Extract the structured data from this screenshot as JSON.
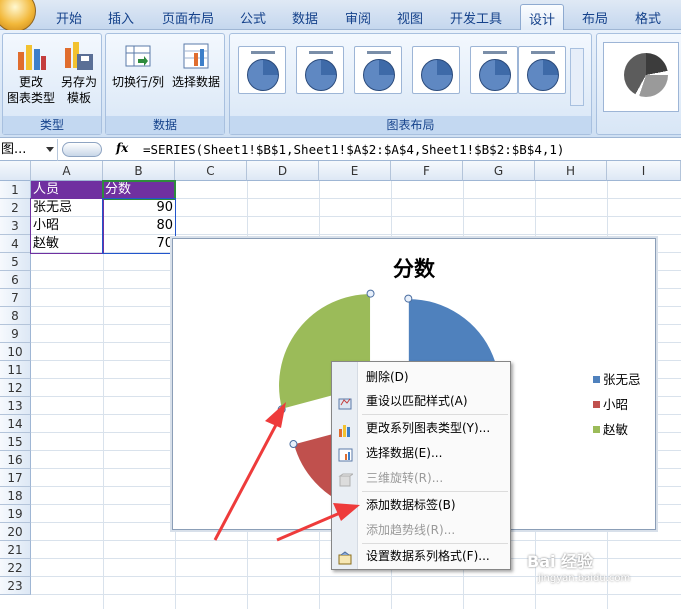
{
  "tabs": [
    "开始",
    "插入",
    "页面布局",
    "公式",
    "数据",
    "审阅",
    "视图",
    "开发工具",
    "设计",
    "布局",
    "格式"
  ],
  "active_tab": "设计",
  "ribbon": {
    "type_group": {
      "label": "类型",
      "change_btn_line1": "更改",
      "change_btn_line2": "图表类型",
      "save_btn_line1": "另存为",
      "save_btn_line2": "模板"
    },
    "data_group": {
      "label": "数据",
      "switch_btn": "切换行/列",
      "select_btn": "选择数据"
    },
    "layout_group": {
      "label": "图表布局"
    },
    "percent_glyph": "%"
  },
  "formula_bar": {
    "name_box": "图...",
    "fx": "fx",
    "formula": "=SERIES(Sheet1!$B$1,Sheet1!$A$2:$A$4,Sheet1!$B$2:$B$4,1)"
  },
  "sheet": {
    "columns": [
      "A",
      "B",
      "C",
      "D",
      "E",
      "F",
      "G",
      "H",
      "I"
    ],
    "rows": [
      "1",
      "2",
      "3",
      "4",
      "5",
      "6",
      "7",
      "8",
      "9",
      "10",
      "11",
      "12",
      "13",
      "14",
      "15",
      "16",
      "17",
      "18",
      "19",
      "20",
      "21",
      "22",
      "23"
    ],
    "header": {
      "a1": "人员",
      "b1": "分数"
    },
    "data": [
      {
        "name": "张无忌",
        "score": "90"
      },
      {
        "name": "小昭",
        "score": "80"
      },
      {
        "name": "赵敏",
        "score": "70"
      }
    ]
  },
  "chart": {
    "title": "分数",
    "legend": [
      "张无忌",
      "小昭",
      "赵敏"
    ],
    "colors": [
      "#4f81bd",
      "#c0504d",
      "#9bbb59"
    ]
  },
  "chart_data": {
    "type": "pie",
    "title": "分数",
    "categories": [
      "张无忌",
      "小昭",
      "赵敏"
    ],
    "values": [
      90,
      80,
      70
    ],
    "legend": "right"
  },
  "context_menu": {
    "items": [
      {
        "label": "删除(D)",
        "enabled": true,
        "icon": "none"
      },
      {
        "label": "重设以匹配样式(A)",
        "enabled": true,
        "icon": "reset-style-icon"
      },
      {
        "label": "更改系列图表类型(Y)...",
        "enabled": true,
        "icon": "chart-type-icon"
      },
      {
        "label": "选择数据(E)...",
        "enabled": true,
        "icon": "select-data-icon"
      },
      {
        "label": "三维旋转(R)...",
        "enabled": false,
        "icon": "rotate-3d-icon"
      },
      {
        "label": "添加数据标签(B)",
        "enabled": true,
        "icon": "none"
      },
      {
        "label": "添加趋势线(R)...",
        "enabled": false,
        "icon": "none"
      },
      {
        "label": "设置数据系列格式(F)...",
        "enabled": true,
        "icon": "format-series-icon"
      }
    ]
  },
  "watermark": {
    "brand": "Bai 经验",
    "url": "jingyan.baidu.com"
  }
}
